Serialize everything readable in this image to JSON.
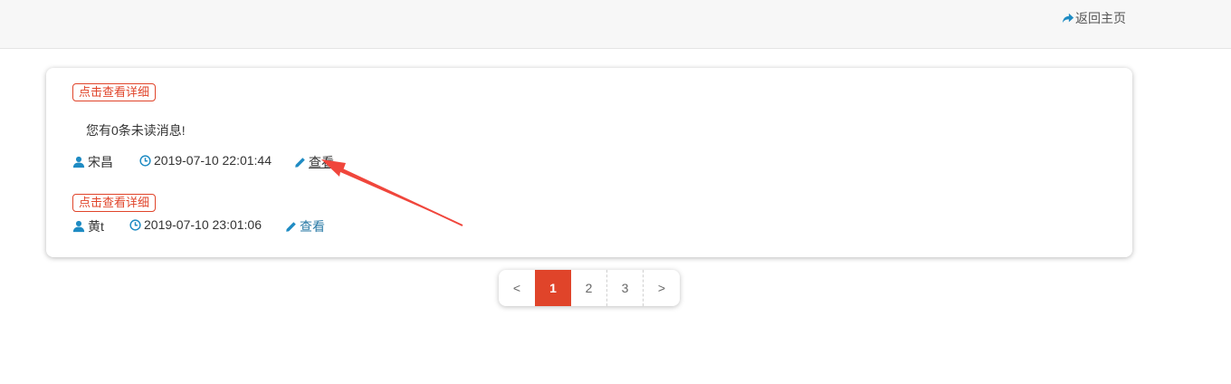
{
  "header": {
    "home_label": "返回主页",
    "home_icon": "share-arrow-icon"
  },
  "messages": [
    {
      "tag": "点击查看详细",
      "text": "您有0条未读消息!",
      "user": "宋昌",
      "time": "2019-07-10 22:01:44",
      "view_label": "查看"
    },
    {
      "tag": "点击查看详细",
      "user": "黄t",
      "time": "2019-07-10 23:01:06",
      "view_label": "查看"
    }
  ],
  "pagination": {
    "prev": "<",
    "pages": [
      "1",
      "2",
      "3"
    ],
    "current": "1",
    "next": ">"
  },
  "colors": {
    "accent_red": "#e0442a",
    "link_blue": "#2a7aa6",
    "icon_blue": "#1e8bc3"
  }
}
